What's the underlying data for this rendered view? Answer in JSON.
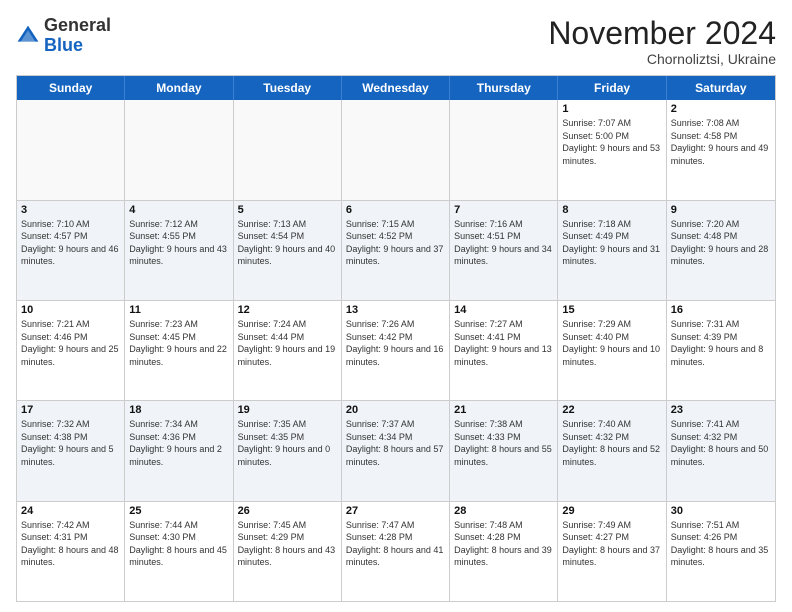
{
  "header": {
    "logo_general": "General",
    "logo_blue": "Blue",
    "month_title": "November 2024",
    "location": "Chornoliztsi, Ukraine"
  },
  "weekdays": [
    "Sunday",
    "Monday",
    "Tuesday",
    "Wednesday",
    "Thursday",
    "Friday",
    "Saturday"
  ],
  "rows": [
    [
      {
        "day": "",
        "info": ""
      },
      {
        "day": "",
        "info": ""
      },
      {
        "day": "",
        "info": ""
      },
      {
        "day": "",
        "info": ""
      },
      {
        "day": "",
        "info": ""
      },
      {
        "day": "1",
        "info": "Sunrise: 7:07 AM\nSunset: 5:00 PM\nDaylight: 9 hours and 53 minutes."
      },
      {
        "day": "2",
        "info": "Sunrise: 7:08 AM\nSunset: 4:58 PM\nDaylight: 9 hours and 49 minutes."
      }
    ],
    [
      {
        "day": "3",
        "info": "Sunrise: 7:10 AM\nSunset: 4:57 PM\nDaylight: 9 hours and 46 minutes."
      },
      {
        "day": "4",
        "info": "Sunrise: 7:12 AM\nSunset: 4:55 PM\nDaylight: 9 hours and 43 minutes."
      },
      {
        "day": "5",
        "info": "Sunrise: 7:13 AM\nSunset: 4:54 PM\nDaylight: 9 hours and 40 minutes."
      },
      {
        "day": "6",
        "info": "Sunrise: 7:15 AM\nSunset: 4:52 PM\nDaylight: 9 hours and 37 minutes."
      },
      {
        "day": "7",
        "info": "Sunrise: 7:16 AM\nSunset: 4:51 PM\nDaylight: 9 hours and 34 minutes."
      },
      {
        "day": "8",
        "info": "Sunrise: 7:18 AM\nSunset: 4:49 PM\nDaylight: 9 hours and 31 minutes."
      },
      {
        "day": "9",
        "info": "Sunrise: 7:20 AM\nSunset: 4:48 PM\nDaylight: 9 hours and 28 minutes."
      }
    ],
    [
      {
        "day": "10",
        "info": "Sunrise: 7:21 AM\nSunset: 4:46 PM\nDaylight: 9 hours and 25 minutes."
      },
      {
        "day": "11",
        "info": "Sunrise: 7:23 AM\nSunset: 4:45 PM\nDaylight: 9 hours and 22 minutes."
      },
      {
        "day": "12",
        "info": "Sunrise: 7:24 AM\nSunset: 4:44 PM\nDaylight: 9 hours and 19 minutes."
      },
      {
        "day": "13",
        "info": "Sunrise: 7:26 AM\nSunset: 4:42 PM\nDaylight: 9 hours and 16 minutes."
      },
      {
        "day": "14",
        "info": "Sunrise: 7:27 AM\nSunset: 4:41 PM\nDaylight: 9 hours and 13 minutes."
      },
      {
        "day": "15",
        "info": "Sunrise: 7:29 AM\nSunset: 4:40 PM\nDaylight: 9 hours and 10 minutes."
      },
      {
        "day": "16",
        "info": "Sunrise: 7:31 AM\nSunset: 4:39 PM\nDaylight: 9 hours and 8 minutes."
      }
    ],
    [
      {
        "day": "17",
        "info": "Sunrise: 7:32 AM\nSunset: 4:38 PM\nDaylight: 9 hours and 5 minutes."
      },
      {
        "day": "18",
        "info": "Sunrise: 7:34 AM\nSunset: 4:36 PM\nDaylight: 9 hours and 2 minutes."
      },
      {
        "day": "19",
        "info": "Sunrise: 7:35 AM\nSunset: 4:35 PM\nDaylight: 9 hours and 0 minutes."
      },
      {
        "day": "20",
        "info": "Sunrise: 7:37 AM\nSunset: 4:34 PM\nDaylight: 8 hours and 57 minutes."
      },
      {
        "day": "21",
        "info": "Sunrise: 7:38 AM\nSunset: 4:33 PM\nDaylight: 8 hours and 55 minutes."
      },
      {
        "day": "22",
        "info": "Sunrise: 7:40 AM\nSunset: 4:32 PM\nDaylight: 8 hours and 52 minutes."
      },
      {
        "day": "23",
        "info": "Sunrise: 7:41 AM\nSunset: 4:32 PM\nDaylight: 8 hours and 50 minutes."
      }
    ],
    [
      {
        "day": "24",
        "info": "Sunrise: 7:42 AM\nSunset: 4:31 PM\nDaylight: 8 hours and 48 minutes."
      },
      {
        "day": "25",
        "info": "Sunrise: 7:44 AM\nSunset: 4:30 PM\nDaylight: 8 hours and 45 minutes."
      },
      {
        "day": "26",
        "info": "Sunrise: 7:45 AM\nSunset: 4:29 PM\nDaylight: 8 hours and 43 minutes."
      },
      {
        "day": "27",
        "info": "Sunrise: 7:47 AM\nSunset: 4:28 PM\nDaylight: 8 hours and 41 minutes."
      },
      {
        "day": "28",
        "info": "Sunrise: 7:48 AM\nSunset: 4:28 PM\nDaylight: 8 hours and 39 minutes."
      },
      {
        "day": "29",
        "info": "Sunrise: 7:49 AM\nSunset: 4:27 PM\nDaylight: 8 hours and 37 minutes."
      },
      {
        "day": "30",
        "info": "Sunrise: 7:51 AM\nSunset: 4:26 PM\nDaylight: 8 hours and 35 minutes."
      }
    ]
  ]
}
